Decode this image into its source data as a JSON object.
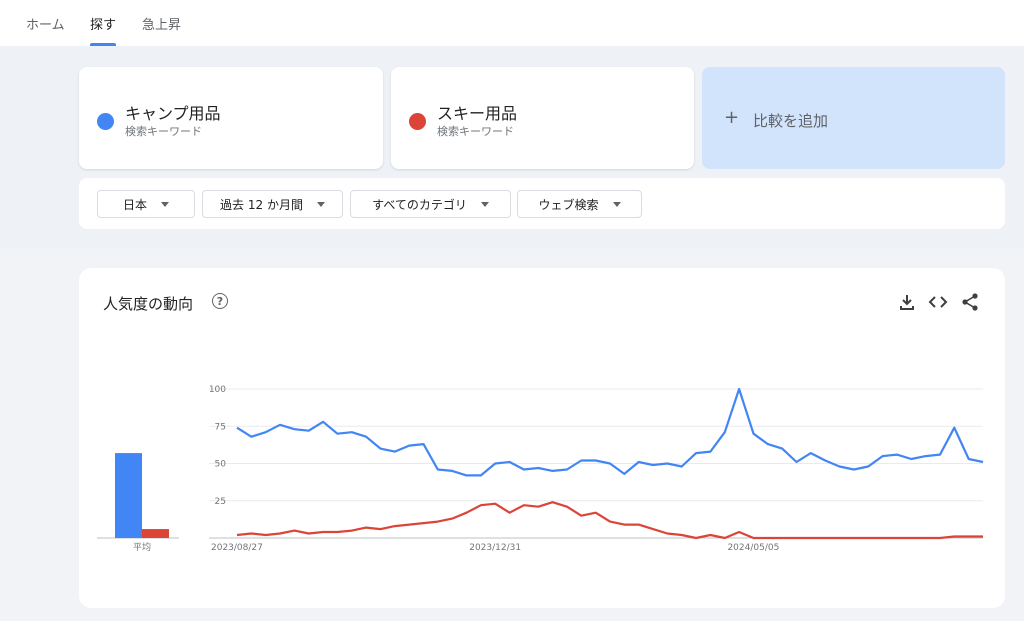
{
  "nav": {
    "tabs": [
      {
        "label": "ホーム"
      },
      {
        "label": "探す"
      },
      {
        "label": "急上昇"
      }
    ],
    "active_index": 1
  },
  "terms": [
    {
      "name": "キャンプ用品",
      "type": "検索キーワード",
      "color": "#4285f4"
    },
    {
      "name": "スキー用品",
      "type": "検索キーワード",
      "color": "#db4437"
    }
  ],
  "add_compare": {
    "label": "比較を追加"
  },
  "filters": {
    "region": "日本",
    "period": "過去 12 か月間",
    "category": "すべてのカテゴリ",
    "search_type": "ウェブ検索"
  },
  "chart_panel": {
    "title": "人気度の動向",
    "average_label": "平均",
    "icons": [
      "download-icon",
      "embed-code-icon",
      "share-icon"
    ]
  },
  "chart_data": {
    "type": "line",
    "ylim": [
      0,
      100
    ],
    "yticks": [
      25,
      50,
      75,
      100
    ],
    "x_tick_labels": [
      {
        "index": 0,
        "label": "2023/08/27"
      },
      {
        "index": 18,
        "label": "2023/12/31"
      },
      {
        "index": 36,
        "label": "2024/05/05"
      }
    ],
    "series": [
      {
        "name": "キャンプ用品",
        "color": "#4285f4",
        "average": 57,
        "values": [
          74,
          68,
          71,
          76,
          73,
          72,
          78,
          70,
          71,
          68,
          60,
          58,
          62,
          63,
          46,
          45,
          42,
          42,
          50,
          51,
          46,
          47,
          45,
          46,
          52,
          52,
          50,
          43,
          51,
          49,
          50,
          48,
          57,
          58,
          71,
          100,
          70,
          63,
          60,
          51,
          57,
          52,
          48,
          46,
          48,
          55,
          56,
          53,
          55,
          56,
          74,
          53,
          51
        ]
      },
      {
        "name": "スキー用品",
        "color": "#db4437",
        "average": 6,
        "values": [
          2,
          3,
          2,
          3,
          5,
          3,
          4,
          4,
          5,
          7,
          6,
          8,
          9,
          10,
          11,
          13,
          17,
          22,
          23,
          17,
          22,
          21,
          24,
          21,
          15,
          17,
          11,
          9,
          9,
          6,
          3,
          2,
          0,
          2,
          0,
          4,
          0,
          0,
          0,
          0,
          0,
          0,
          0,
          0,
          0,
          0,
          0,
          0,
          0,
          0,
          1,
          1,
          1
        ]
      }
    ]
  }
}
